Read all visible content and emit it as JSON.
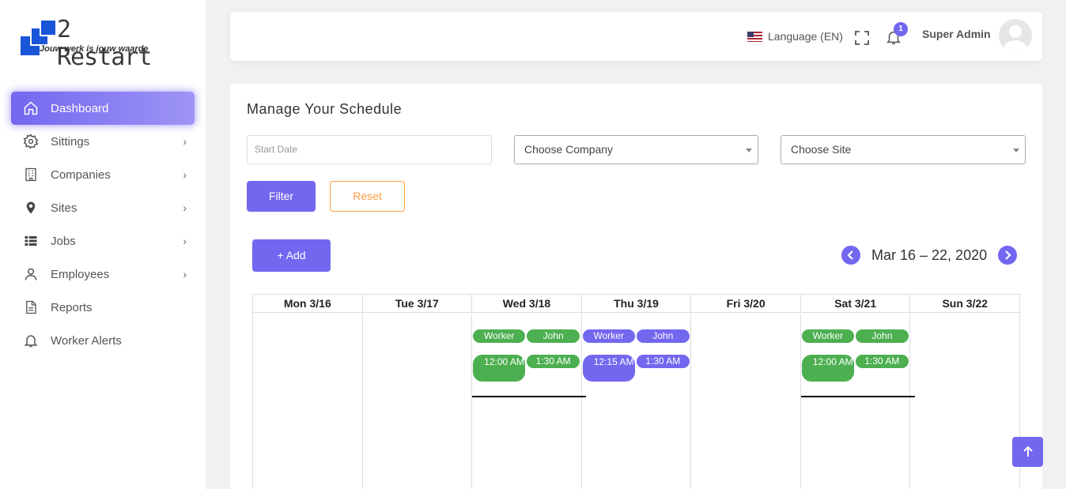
{
  "brand": {
    "name": "2 Restart",
    "tagline": "Jouw werk is jouw waarde"
  },
  "sidebar": {
    "items": [
      {
        "label": "Dashboard",
        "icon": "home-icon",
        "active": true
      },
      {
        "label": "Sittings",
        "icon": "gear-icon",
        "chevron": true
      },
      {
        "label": "Companies",
        "icon": "building-icon",
        "chevron": true
      },
      {
        "label": "Sites",
        "icon": "map-pin-icon",
        "chevron": true
      },
      {
        "label": "Jobs",
        "icon": "list-icon",
        "chevron": true
      },
      {
        "label": "Employees",
        "icon": "user-icon",
        "chevron": true
      },
      {
        "label": "Reports",
        "icon": "file-icon"
      },
      {
        "label": "Worker Alerts",
        "icon": "bell-icon"
      }
    ]
  },
  "header": {
    "language": "Language (EN)",
    "notifications_count": "1",
    "user_name": "Super Admin"
  },
  "schedule": {
    "title": "Manage Your Schedule",
    "start_date_placeholder": "Start Date",
    "company_select": "Choose Company",
    "site_select": "Choose Site",
    "filter_label": "Filter",
    "reset_label": "Reset",
    "add_label": "Add",
    "range_label": "Mar 16 – 22, 2020"
  },
  "calendar": {
    "days": [
      "Mon 3/16",
      "Tue 3/17",
      "Wed 3/18",
      "Thu 3/19",
      "Fri 3/20",
      "Sat 3/21",
      "Sun 3/22"
    ],
    "events": {
      "wed": {
        "pill1": "Worker",
        "pill2": "John",
        "start": "12:00 AM",
        "end": "1:30 AM"
      },
      "thu": {
        "pill1": "Worker",
        "pill2": "John",
        "start": "12:15 AM",
        "end": "1:30 AM"
      },
      "sat": {
        "pill1": "Worker",
        "pill2": "John",
        "start": "12:00 AM",
        "end": "1:30 AM"
      }
    }
  },
  "colors": {
    "accent": "#7367f0",
    "reset": "#ff9f43",
    "event_green": "#4caf50"
  }
}
